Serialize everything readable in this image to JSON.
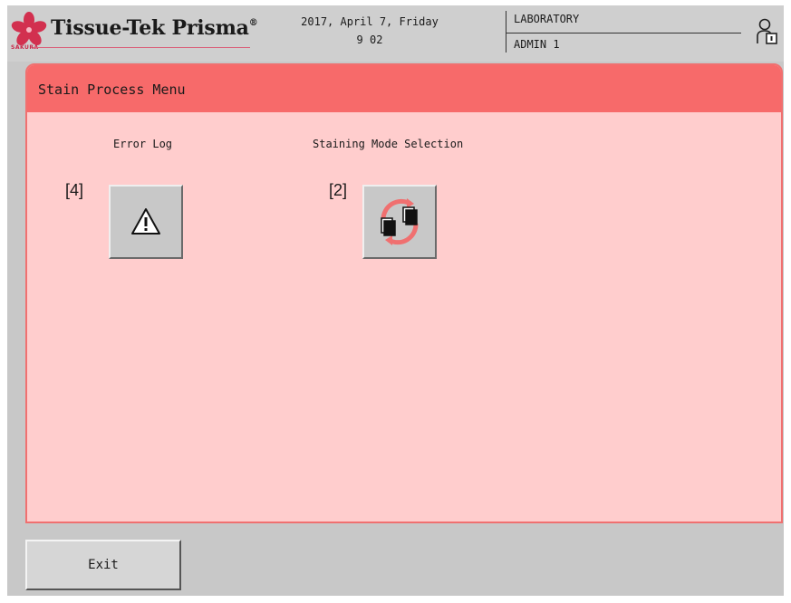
{
  "header": {
    "brand": "Tissue-Tek Prisma",
    "brand_mark": "®",
    "brand_sub": "SAKURA",
    "date": "2017, April 7, Friday",
    "time": "9 02",
    "user_role": "LABORATORY",
    "user_name": "ADMIN 1",
    "user_icon": "user-lock-icon"
  },
  "panel": {
    "title": "Stain Process Menu",
    "items": [
      {
        "label": "Error Log",
        "badge": "[4]",
        "icon": "warning-icon"
      },
      {
        "label": "Staining Mode Selection",
        "badge": "[2]",
        "icon": "mode-switch-icon"
      }
    ]
  },
  "footer": {
    "exit_label": "Exit"
  },
  "colors": {
    "panel_bg": "#ffcdcd",
    "title_bar": "#f76a6a",
    "panel_border": "#f07070",
    "frame_gray": "#c8c8c8",
    "brand_pink": "#c8284a"
  }
}
